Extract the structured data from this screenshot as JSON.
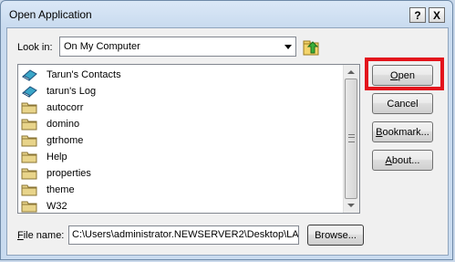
{
  "window": {
    "title": "Open Application",
    "help_label": "?",
    "close_label": "X"
  },
  "lookin": {
    "label": "Look in:",
    "value": "On My Computer"
  },
  "files": [
    {
      "name": "Tarun's Contacts",
      "icon": "address-book-icon"
    },
    {
      "name": "tarun's Log",
      "icon": "address-book-icon"
    },
    {
      "name": "autocorr",
      "icon": "folder-icon"
    },
    {
      "name": "domino",
      "icon": "folder-icon"
    },
    {
      "name": "gtrhome",
      "icon": "folder-icon"
    },
    {
      "name": "Help",
      "icon": "folder-icon"
    },
    {
      "name": "properties",
      "icon": "folder-icon"
    },
    {
      "name": "theme",
      "icon": "folder-icon"
    },
    {
      "name": "W32",
      "icon": "folder-icon"
    }
  ],
  "filename": {
    "label": "File name:",
    "value": "C:\\Users\\administrator.NEWSERVER2\\Desktop\\LA"
  },
  "buttons": {
    "open": "Open",
    "cancel": "Cancel",
    "bookmark": "Bookmark...",
    "about": "About...",
    "browse": "Browse..."
  },
  "colors": {
    "highlight": "#e3141c",
    "folder": "#e8d48a",
    "book": "#3aa6c8"
  }
}
